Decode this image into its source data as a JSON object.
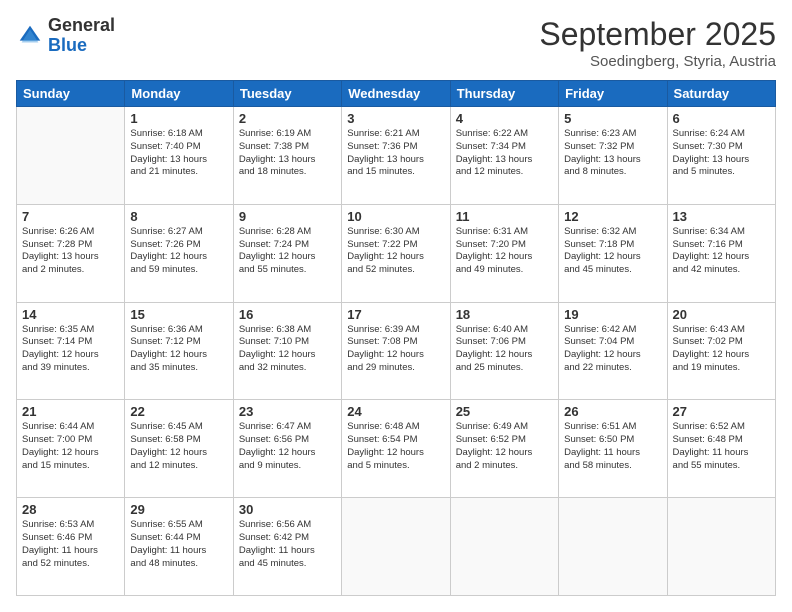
{
  "header": {
    "logo_general": "General",
    "logo_blue": "Blue",
    "month_title": "September 2025",
    "subtitle": "Soedingberg, Styria, Austria"
  },
  "days_of_week": [
    "Sunday",
    "Monday",
    "Tuesday",
    "Wednesday",
    "Thursday",
    "Friday",
    "Saturday"
  ],
  "weeks": [
    [
      {
        "day": "",
        "info": ""
      },
      {
        "day": "1",
        "info": "Sunrise: 6:18 AM\nSunset: 7:40 PM\nDaylight: 13 hours\nand 21 minutes."
      },
      {
        "day": "2",
        "info": "Sunrise: 6:19 AM\nSunset: 7:38 PM\nDaylight: 13 hours\nand 18 minutes."
      },
      {
        "day": "3",
        "info": "Sunrise: 6:21 AM\nSunset: 7:36 PM\nDaylight: 13 hours\nand 15 minutes."
      },
      {
        "day": "4",
        "info": "Sunrise: 6:22 AM\nSunset: 7:34 PM\nDaylight: 13 hours\nand 12 minutes."
      },
      {
        "day": "5",
        "info": "Sunrise: 6:23 AM\nSunset: 7:32 PM\nDaylight: 13 hours\nand 8 minutes."
      },
      {
        "day": "6",
        "info": "Sunrise: 6:24 AM\nSunset: 7:30 PM\nDaylight: 13 hours\nand 5 minutes."
      }
    ],
    [
      {
        "day": "7",
        "info": "Sunrise: 6:26 AM\nSunset: 7:28 PM\nDaylight: 13 hours\nand 2 minutes."
      },
      {
        "day": "8",
        "info": "Sunrise: 6:27 AM\nSunset: 7:26 PM\nDaylight: 12 hours\nand 59 minutes."
      },
      {
        "day": "9",
        "info": "Sunrise: 6:28 AM\nSunset: 7:24 PM\nDaylight: 12 hours\nand 55 minutes."
      },
      {
        "day": "10",
        "info": "Sunrise: 6:30 AM\nSunset: 7:22 PM\nDaylight: 12 hours\nand 52 minutes."
      },
      {
        "day": "11",
        "info": "Sunrise: 6:31 AM\nSunset: 7:20 PM\nDaylight: 12 hours\nand 49 minutes."
      },
      {
        "day": "12",
        "info": "Sunrise: 6:32 AM\nSunset: 7:18 PM\nDaylight: 12 hours\nand 45 minutes."
      },
      {
        "day": "13",
        "info": "Sunrise: 6:34 AM\nSunset: 7:16 PM\nDaylight: 12 hours\nand 42 minutes."
      }
    ],
    [
      {
        "day": "14",
        "info": "Sunrise: 6:35 AM\nSunset: 7:14 PM\nDaylight: 12 hours\nand 39 minutes."
      },
      {
        "day": "15",
        "info": "Sunrise: 6:36 AM\nSunset: 7:12 PM\nDaylight: 12 hours\nand 35 minutes."
      },
      {
        "day": "16",
        "info": "Sunrise: 6:38 AM\nSunset: 7:10 PM\nDaylight: 12 hours\nand 32 minutes."
      },
      {
        "day": "17",
        "info": "Sunrise: 6:39 AM\nSunset: 7:08 PM\nDaylight: 12 hours\nand 29 minutes."
      },
      {
        "day": "18",
        "info": "Sunrise: 6:40 AM\nSunset: 7:06 PM\nDaylight: 12 hours\nand 25 minutes."
      },
      {
        "day": "19",
        "info": "Sunrise: 6:42 AM\nSunset: 7:04 PM\nDaylight: 12 hours\nand 22 minutes."
      },
      {
        "day": "20",
        "info": "Sunrise: 6:43 AM\nSunset: 7:02 PM\nDaylight: 12 hours\nand 19 minutes."
      }
    ],
    [
      {
        "day": "21",
        "info": "Sunrise: 6:44 AM\nSunset: 7:00 PM\nDaylight: 12 hours\nand 15 minutes."
      },
      {
        "day": "22",
        "info": "Sunrise: 6:45 AM\nSunset: 6:58 PM\nDaylight: 12 hours\nand 12 minutes."
      },
      {
        "day": "23",
        "info": "Sunrise: 6:47 AM\nSunset: 6:56 PM\nDaylight: 12 hours\nand 9 minutes."
      },
      {
        "day": "24",
        "info": "Sunrise: 6:48 AM\nSunset: 6:54 PM\nDaylight: 12 hours\nand 5 minutes."
      },
      {
        "day": "25",
        "info": "Sunrise: 6:49 AM\nSunset: 6:52 PM\nDaylight: 12 hours\nand 2 minutes."
      },
      {
        "day": "26",
        "info": "Sunrise: 6:51 AM\nSunset: 6:50 PM\nDaylight: 11 hours\nand 58 minutes."
      },
      {
        "day": "27",
        "info": "Sunrise: 6:52 AM\nSunset: 6:48 PM\nDaylight: 11 hours\nand 55 minutes."
      }
    ],
    [
      {
        "day": "28",
        "info": "Sunrise: 6:53 AM\nSunset: 6:46 PM\nDaylight: 11 hours\nand 52 minutes."
      },
      {
        "day": "29",
        "info": "Sunrise: 6:55 AM\nSunset: 6:44 PM\nDaylight: 11 hours\nand 48 minutes."
      },
      {
        "day": "30",
        "info": "Sunrise: 6:56 AM\nSunset: 6:42 PM\nDaylight: 11 hours\nand 45 minutes."
      },
      {
        "day": "",
        "info": ""
      },
      {
        "day": "",
        "info": ""
      },
      {
        "day": "",
        "info": ""
      },
      {
        "day": "",
        "info": ""
      }
    ]
  ]
}
